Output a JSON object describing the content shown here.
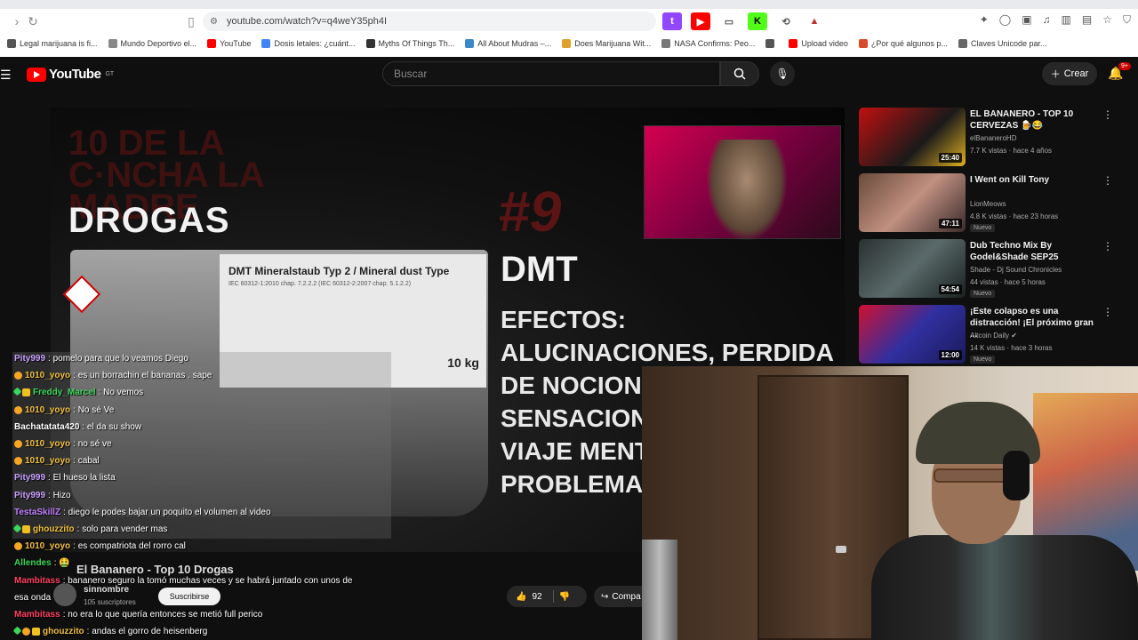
{
  "browser": {
    "url": "youtube.com/watch?v=q4weY35ph4I",
    "bookmarks": [
      {
        "label": "Legal marijuana is fi...",
        "color": "#555"
      },
      {
        "label": "Mundo Deportivo el...",
        "color": "#888"
      },
      {
        "label": "YouTube",
        "color": "#ff0000"
      },
      {
        "label": "Dosis letales: ¿cuánt...",
        "color": "#4285f4"
      },
      {
        "label": "Myths Of Things Th...",
        "color": "#333"
      },
      {
        "label": "All About Mudras –...",
        "color": "#3a88c8"
      },
      {
        "label": "Does Marijuana Wit...",
        "color": "#e0a030"
      },
      {
        "label": "NASA Confirms: Peo...",
        "color": "#777"
      },
      {
        "label": "",
        "color": "#555"
      },
      {
        "label": "Upload video",
        "color": "#ff0000"
      },
      {
        "label": "¿Por qué algunos p...",
        "color": "#d84a2a"
      },
      {
        "label": "Claves Unicode par...",
        "color": "#666"
      }
    ]
  },
  "header": {
    "logo_text": "YouTube",
    "country": "GT",
    "search_placeholder": "Buscar",
    "create_label": "Crear",
    "notif_count": "9+"
  },
  "video": {
    "overlay_logo": "10 DE LA C·NCHA LA MADRE",
    "category": "DROGAS",
    "rank": "#9",
    "drug": "DMT",
    "effects": "EFECTOS:\nALUCINACIONES, PERDIDA\nDE NOCION\nSENSACION\nVIAJE MENTA\nPROBLEMAS",
    "jar_title": "DMT Mineralstaub Typ 2 / Mineral dust Type",
    "jar_small": "IEC 60312-1:2010 chap. 7.2.2.2 (IEC 60312-2:2007 chap. 5.1.2.2)",
    "jar_weight": "10 kg",
    "title": "El Bananero - Top 10 Drogas",
    "channel": "sinnombre",
    "subscribers": "105 suscriptores",
    "subscribe_label": "Suscribirse",
    "likes": "92",
    "share_label": "Compa"
  },
  "recommendations": [
    {
      "title": "EL BANANERO - TOP 10 CERVEZAS 🍺😂",
      "channel": "elBananeroHD",
      "stats": "7.7 K vistas · hace 4 años",
      "duration": "25:40",
      "badge": "",
      "thumb": "linear-gradient(135deg,#c01010,#1a1a1a 60%,#e0b020)"
    },
    {
      "title": "I Went on Kill Tony",
      "channel": "LionMeows",
      "stats": "4.8 K vistas · hace 23 horas",
      "duration": "47:11",
      "badge": "Nuevo",
      "thumb": "linear-gradient(135deg,#6a4a3a,#c09080 50%,#3a2a2a)"
    },
    {
      "title": "Dub Techno Mix By Godel&Shade SEP25",
      "channel": "Shade - Dj Sound Chronicles",
      "stats": "44 vistas · hace 5 horas",
      "duration": "54:54",
      "badge": "Nuevo",
      "thumb": "linear-gradient(135deg,#2a3030,#5a6a6a 50%,#1a2020)"
    },
    {
      "title": "¡Este colapso es una distracción! ¡El próximo gran ...",
      "channel": "Altcoin Daily ✔",
      "stats": "14 K vistas · hace 3 horas",
      "duration": "12:00",
      "badge": "Nuevo",
      "thumb": "linear-gradient(135deg,#d01030,#3030a0 50%,#1a1a5a)"
    }
  ],
  "chat": [
    {
      "user": "Pity999",
      "color": "#c9a0ff",
      "text": ": pomelo para que lo veamos Diego",
      "badges": []
    },
    {
      "user": "1010_yoyo",
      "color": "#f0c040",
      "text": ": es un borrachin el bananas . sape",
      "badges": [
        "gold"
      ]
    },
    {
      "user": "Freddy_Marcel",
      "color": "#3ad85a",
      "text": ": No vemos",
      "badges": [
        "green",
        "star"
      ]
    },
    {
      "user": "1010_yoyo",
      "color": "#f0c040",
      "text": ": No sé Ve",
      "badges": [
        "gold"
      ]
    },
    {
      "user": "Bachatatata420",
      "color": "#ffffff",
      "text": ": el da su show",
      "badges": []
    },
    {
      "user": "1010_yoyo",
      "color": "#f0c040",
      "text": ": no sé ve",
      "badges": [
        "gold"
      ]
    },
    {
      "user": "1010_yoyo",
      "color": "#f0c040",
      "text": ": cabal",
      "badges": [
        "gold"
      ]
    },
    {
      "user": "Pity999",
      "color": "#c9a0ff",
      "text": ": El hueso la lista",
      "badges": []
    },
    {
      "user": "Pity999",
      "color": "#c9a0ff",
      "text": ": Hizo",
      "badges": []
    },
    {
      "user": "TestaSkillZ",
      "color": "#c080ff",
      "text": ": diego le podes bajar un poquito el volumen al video",
      "badges": []
    },
    {
      "user": "ghouzzito",
      "color": "#f0c040",
      "text": ": solo para vender mas",
      "badges": [
        "green",
        "star"
      ]
    },
    {
      "user": "1010_yoyo",
      "color": "#f0c040",
      "text": ": es compatriota del rorro cal",
      "badges": [
        "gold"
      ]
    },
    {
      "user": "Allendes",
      "color": "#3ad85a",
      "text": ": 🤮",
      "badges": []
    },
    {
      "user": "Mambitass",
      "color": "#ff4060",
      "text": ": bananero seguro la tomó muchas veces y se habrá juntado con unos de",
      "badges": []
    },
    {
      "user": "",
      "color": "#ffffff",
      "text": "esa onda",
      "badges": []
    },
    {
      "user": "Mambitass",
      "color": "#ff4060",
      "text": ": no era lo que quería entonces se metió full perico",
      "badges": []
    },
    {
      "user": "ghouzzito",
      "color": "#f0c040",
      "text": ": andas el gorro de heisenberg",
      "badges": [
        "green",
        "gold",
        "star"
      ]
    }
  ]
}
